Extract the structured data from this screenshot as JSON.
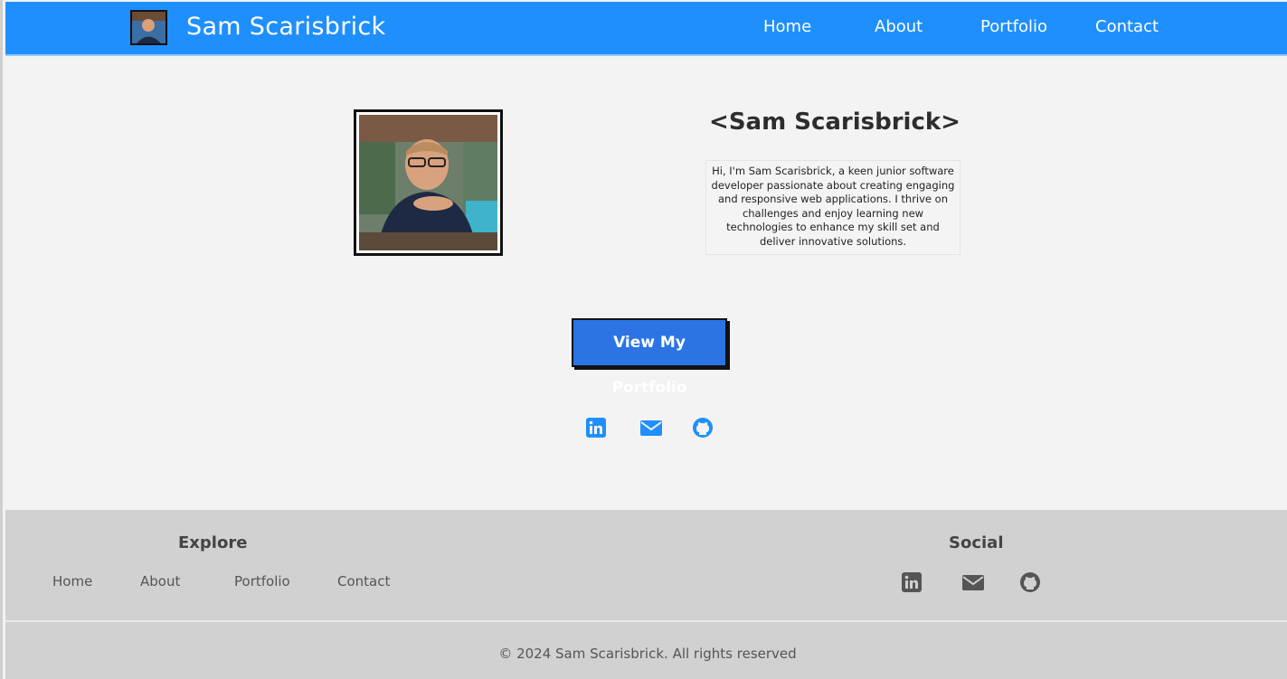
{
  "navbar": {
    "brand_name": "Sam Scarisbrick",
    "links": [
      {
        "label": "Home"
      },
      {
        "label": "About"
      },
      {
        "label": "Portfolio"
      },
      {
        "label": "Contact"
      }
    ]
  },
  "hero": {
    "name": "<Sam Scarisbrick>",
    "bio": "Hi, I'm Sam Scarisbrick, a keen junior software developer passionate about creating engaging and responsive web applications. I thrive on challenges and enjoy learning new technologies to enhance my skill set and deliver innovative solutions.",
    "cta_label": "View My Portfolio",
    "social_icons": [
      "linkedin-icon",
      "email-icon",
      "github-icon"
    ]
  },
  "footer": {
    "explore_heading": "Explore",
    "explore_links": [
      {
        "label": "Home"
      },
      {
        "label": "About"
      },
      {
        "label": "Portfolio"
      },
      {
        "label": "Contact"
      }
    ],
    "social_heading": "Social",
    "social_icons": [
      "linkedin-icon",
      "email-icon",
      "github-icon"
    ],
    "copyright": "© 2024 Sam Scarisbrick. All rights reserved"
  },
  "colors": {
    "nav_bg": "#1f8ffe",
    "accent": "#2c74e4",
    "hero_icon": "#1f8ffe",
    "footer_bg": "#d1d1d1",
    "footer_icon": "#555555"
  }
}
